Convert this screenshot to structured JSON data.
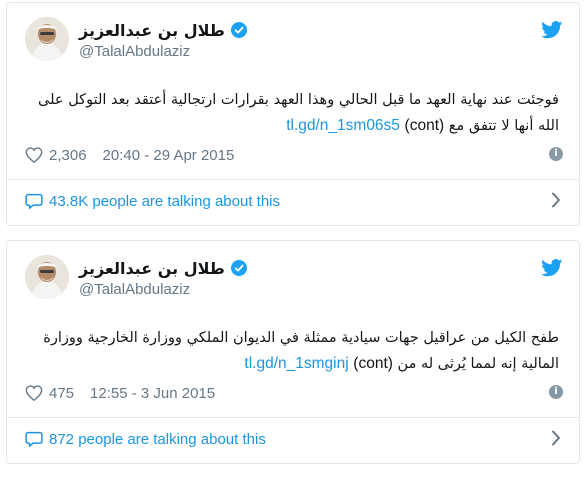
{
  "tweets": [
    {
      "display_name": "طلال بن عبدالعزيز",
      "handle": "@TalalAbdulaziz",
      "text_line1": "فوجئت عند نهاية العهد ما قبل الحالي وهذا العهد بقرارات ارتجالية أعتقد بعد التوكل على",
      "text_line2_prefix": "الله أنها لا تتفق مع",
      "cont": "(cont)",
      "link": "tl.gd/n_1sm06s5",
      "likes": "2,306",
      "timestamp": "20:40 - 29 Apr 2015",
      "talking": "43.8K people are talking about this"
    },
    {
      "display_name": "طلال بن عبدالعزيز",
      "handle": "@TalalAbdulaziz",
      "text_line1": "طفح الكيل من عراقيل جهات سيادية ممثلة في الديوان الملكي ووزارة الخارجية ووزارة",
      "text_line2_prefix": "المالية إنه لمما يُرثى له من",
      "cont": "(cont)",
      "link": "tl.gd/n_1smginj",
      "likes": "475",
      "timestamp": "12:55 - 3 Jun 2015",
      "talking": "872 people are talking about this"
    }
  ],
  "colors": {
    "accent": "#1b95e0",
    "muted": "#657786",
    "border": "#e1e8ed",
    "twitter_blue": "#1da1f2"
  },
  "icons": [
    "twitter-bird-icon",
    "verified-badge-icon",
    "heart-icon",
    "info-icon",
    "speech-bubble-icon",
    "chevron-right-icon"
  ]
}
